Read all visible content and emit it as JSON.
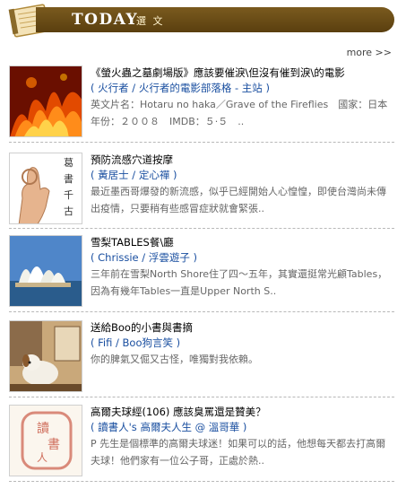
{
  "header": {
    "title": "TODAY",
    "subtitle": "選 文",
    "more_label": "more >>"
  },
  "items": [
    {
      "title": "《螢火蟲之墓劇場版》應該要催淚\\但沒有催到淚\\的電影",
      "author": "( 火行者 / 火行者的電影部落格 - 主站 )",
      "excerpt": "英文片名：Hotaru no haka／Grave of the Fireflies　國家：日本　年份：２００８　IMDB：５·５　.."
    },
    {
      "title": "預防流感穴道按摩",
      "author": "( 黃居士 / 定心禪 )",
      "excerpt": "最近墨西哥爆發的新流感，似乎已經開始人心惶惶，即使台灣尚未傳出疫情，只要稍有些感冒症狀就會緊張.."
    },
    {
      "title": "雪梨TABLES餐\\廳",
      "author": "( Chrissie / 浮雲遊子 )",
      "excerpt": "三年前在雪梨North Shore住了四～五年，其實還挺常光顧Tables，因為有幾年Tables一直是Upper North S.."
    },
    {
      "title": "送給Boo的小書與書摘",
      "author": "( Fifi / Boo狗言笑 )",
      "excerpt": "你的脾氣又倔又古怪，唯獨對我依賴。"
    },
    {
      "title": "高爾夫球經(106) 應該臭罵還是贊美？",
      "author": "( 讀書人's 高爾夫人生 @ 溫哥華 )",
      "excerpt": "P 先生是個標準的高爾夫球迷！如果可以的話，他想每天都去打高爾夫球！他們家有一位公子哥，正處於熱.."
    }
  ],
  "thumb_text": {
    "calligraphy": "葛書千古",
    "seal": "讀書人"
  }
}
